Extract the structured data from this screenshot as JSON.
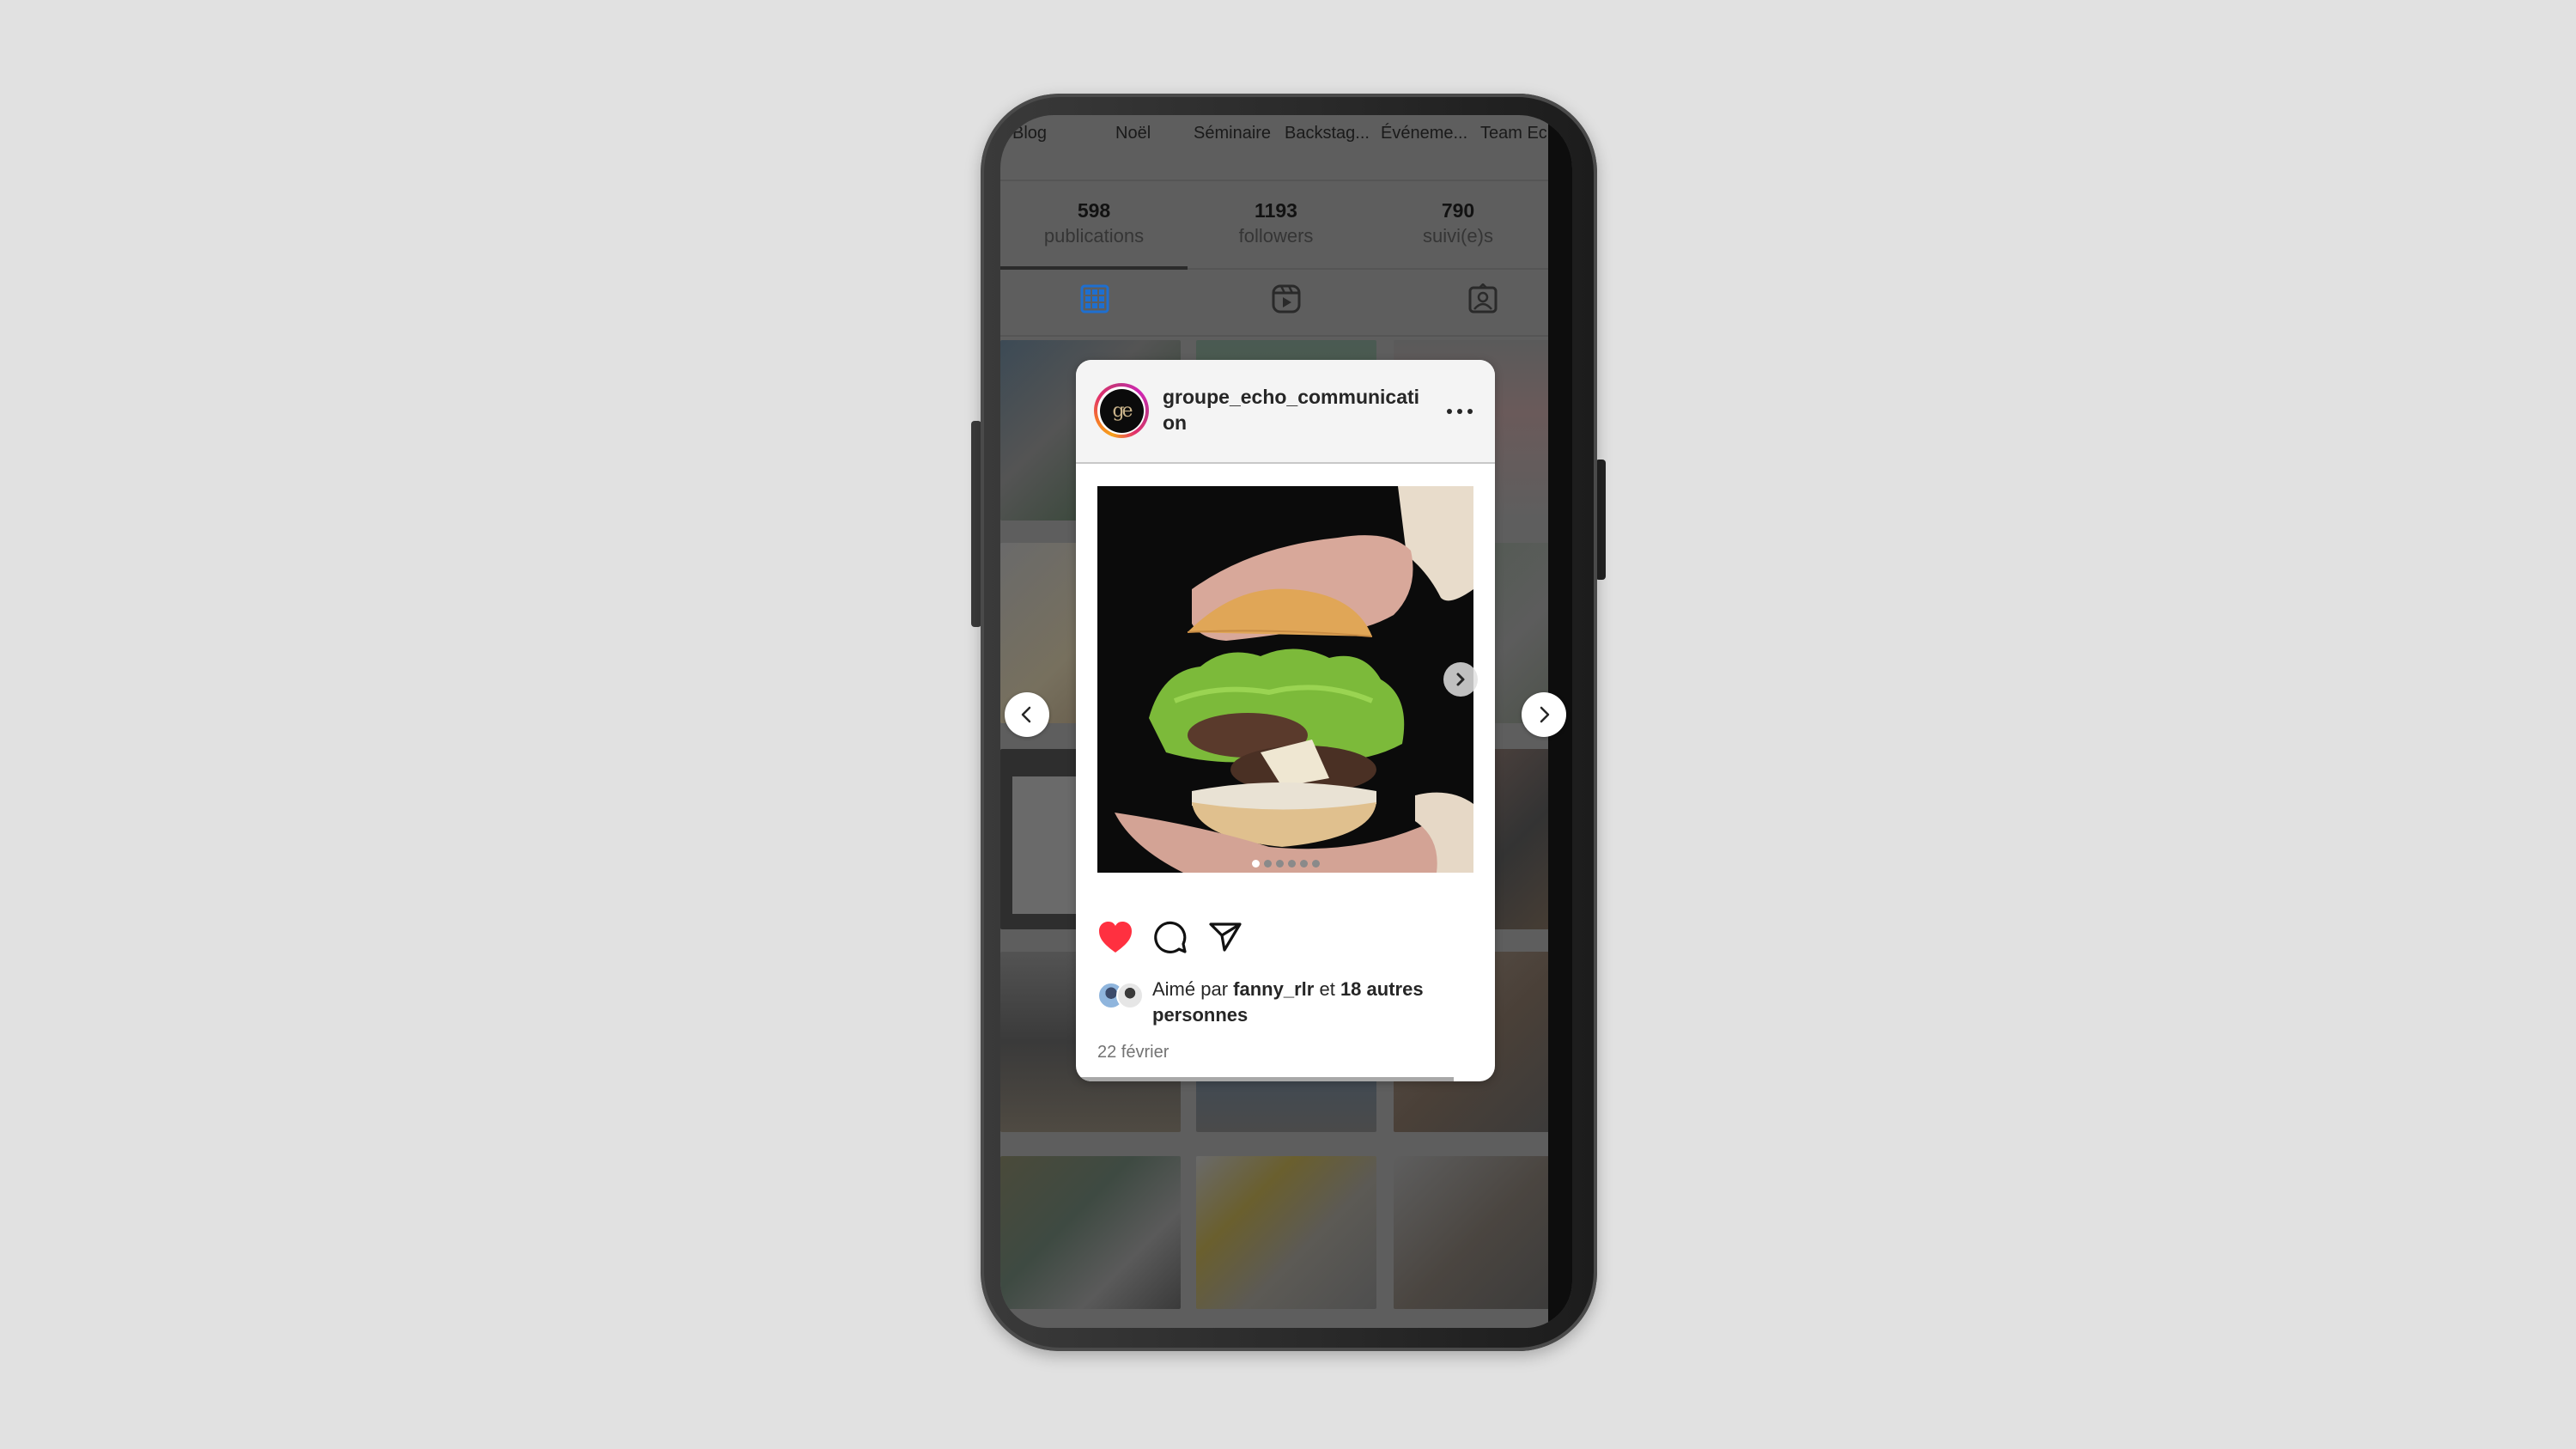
{
  "highlights": [
    {
      "label": "Blog"
    },
    {
      "label": "Noël"
    },
    {
      "label": "Séminaire"
    },
    {
      "label": "Backstag..."
    },
    {
      "label": "Événeme..."
    },
    {
      "label": "Team Echo"
    }
  ],
  "stats": [
    {
      "value": "598",
      "label": "publications"
    },
    {
      "value": "1193",
      "label": "followers"
    },
    {
      "value": "790",
      "label": "suivi(e)s"
    }
  ],
  "tabs": [
    {
      "icon": "grid-icon",
      "active": true
    },
    {
      "icon": "reels-icon",
      "active": false
    },
    {
      "icon": "tagged-icon",
      "active": false
    }
  ],
  "colors": {
    "active_tab": "#1e6fd0",
    "like_heart": "#ff3040",
    "ring_start": "#f7a21b",
    "ring_end": "#d026b3"
  },
  "post": {
    "username": "groupe_echo_communication",
    "avatar_monogram": "ge",
    "image_alt": "Mains tenant un burger avec laitue, steak et fromage sur fond noir",
    "carousel": {
      "current": 1,
      "total": 6
    },
    "liked": true,
    "likes_prefix": "Aimé par",
    "likes_user": "fanny_rlr",
    "likes_connector": "et",
    "likes_others": "18 autres personnes",
    "date": "22 février"
  },
  "icons": {
    "more": "more-options-icon",
    "like": "heart-icon",
    "comment": "comment-icon",
    "share": "send-icon",
    "prev": "chevron-left-icon",
    "next": "chevron-right-icon"
  }
}
